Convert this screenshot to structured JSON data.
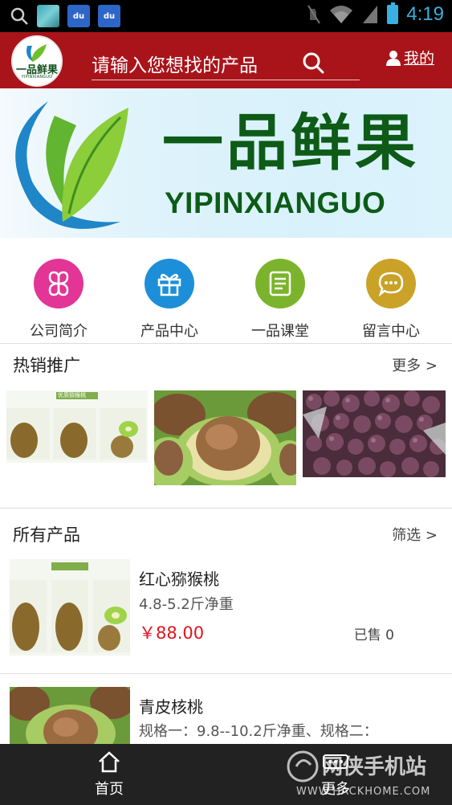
{
  "status_bar": {
    "time": "4:19",
    "left_icons": [
      "search-icon",
      "image-notification-icon",
      "baidu-paw-icon",
      "baidu-paw-icon"
    ],
    "right_icons": [
      "mute-icon",
      "wifi-icon",
      "signal-icon",
      "battery-icon"
    ],
    "paw_label": "du"
  },
  "header": {
    "logo_text": "一品鲜果",
    "logo_sub": "YIPINXIANGUO",
    "search_placeholder": "请输入您想找的产品",
    "mine_label": "我的",
    "bg_color": "#a9141b"
  },
  "banner": {
    "title": "一品鲜果",
    "pinyin": "YIPINXIANGUO"
  },
  "categories": [
    {
      "label": "公司简介",
      "icon": "clover-icon",
      "color": "#e23596"
    },
    {
      "label": "产品中心",
      "icon": "gift-icon",
      "color": "#1d8fd8"
    },
    {
      "label": "一品课堂",
      "icon": "notepad-icon",
      "color": "#7bb42c"
    },
    {
      "label": "留言中心",
      "icon": "chat-bubble-icon",
      "color": "#c9a227"
    }
  ],
  "hot": {
    "title": "热销推广",
    "more": "更多 >",
    "card_caption": "优质猕猴桃"
  },
  "all_products": {
    "title": "所有产品",
    "filter": "筛选 >",
    "items": [
      {
        "name": "红心猕猴桃",
        "spec": "4.8-5.2斤净重",
        "price": "￥88.00",
        "sold": "已售 0"
      },
      {
        "name": "青皮核桃",
        "spec": "规格一：9.8--10.2斤净重、规格二："
      }
    ]
  },
  "tabbar": {
    "home": "首页",
    "more": "更多"
  },
  "watermark": {
    "text": "网侠手机站",
    "url": "WWW.HACKHOME.COM"
  }
}
